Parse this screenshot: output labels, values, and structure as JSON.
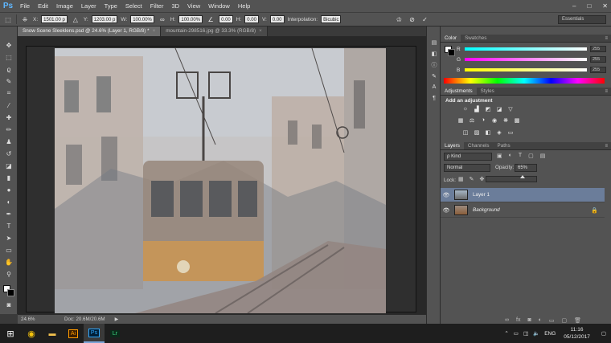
{
  "menubar": {
    "logo": "Ps",
    "items": [
      "File",
      "Edit",
      "Image",
      "Layer",
      "Type",
      "Select",
      "Filter",
      "3D",
      "View",
      "Window",
      "Help"
    ],
    "window_controls": [
      "–",
      "□",
      "✕"
    ]
  },
  "options": {
    "x_label": "X:",
    "x_value": "1501.00 p",
    "y_label": "Y:",
    "y_value": "1203.00 p",
    "w_label": "W:",
    "w_value": "100.00%",
    "h_label": "H:",
    "h_value": "100.00%",
    "angle_value": "0.00",
    "hskew_label": "H:",
    "hskew_value": "0.00",
    "vskew_label": "V:",
    "vskew_value": "0.00",
    "interp_label": "Interpolation:",
    "interp_value": "Bicubic",
    "workspace": "Essentials"
  },
  "tabs": [
    {
      "label": "Snow Scene Sleeklens.psd @ 24.6% (Layer 1, RGB/8) *",
      "active": true
    },
    {
      "label": "mountain-298516.jpg @ 33.3% (RGB/8)",
      "active": false
    }
  ],
  "status": {
    "zoom": "24.6%",
    "doc": "Doc: 20.6M/20.6M"
  },
  "color_panel": {
    "tabs": [
      "Color",
      "Swatches"
    ],
    "channels": [
      {
        "letter": "R",
        "value": "255",
        "track": "#00ffff"
      },
      {
        "letter": "G",
        "value": "255",
        "track": "#ff00ff"
      },
      {
        "letter": "B",
        "value": "255",
        "track": "#ffff00"
      }
    ]
  },
  "adjustments_panel": {
    "tabs": [
      "Adjustments",
      "Styles"
    ],
    "title": "Add an adjustment"
  },
  "layers_panel": {
    "tabs": [
      "Layers",
      "Channels",
      "Paths"
    ],
    "kind": "ρ Kind",
    "blend_mode": "Normal",
    "opacity_label": "Opacity:",
    "opacity_value": "65%",
    "lock_label": "Lock:",
    "layers": [
      {
        "name": "Layer 1",
        "selected": true,
        "locked": false
      },
      {
        "name": "Background",
        "selected": false,
        "locked": true
      }
    ]
  },
  "taskbar": {
    "lang": "ENG",
    "time": "11:16",
    "date": "05/12/2017"
  }
}
